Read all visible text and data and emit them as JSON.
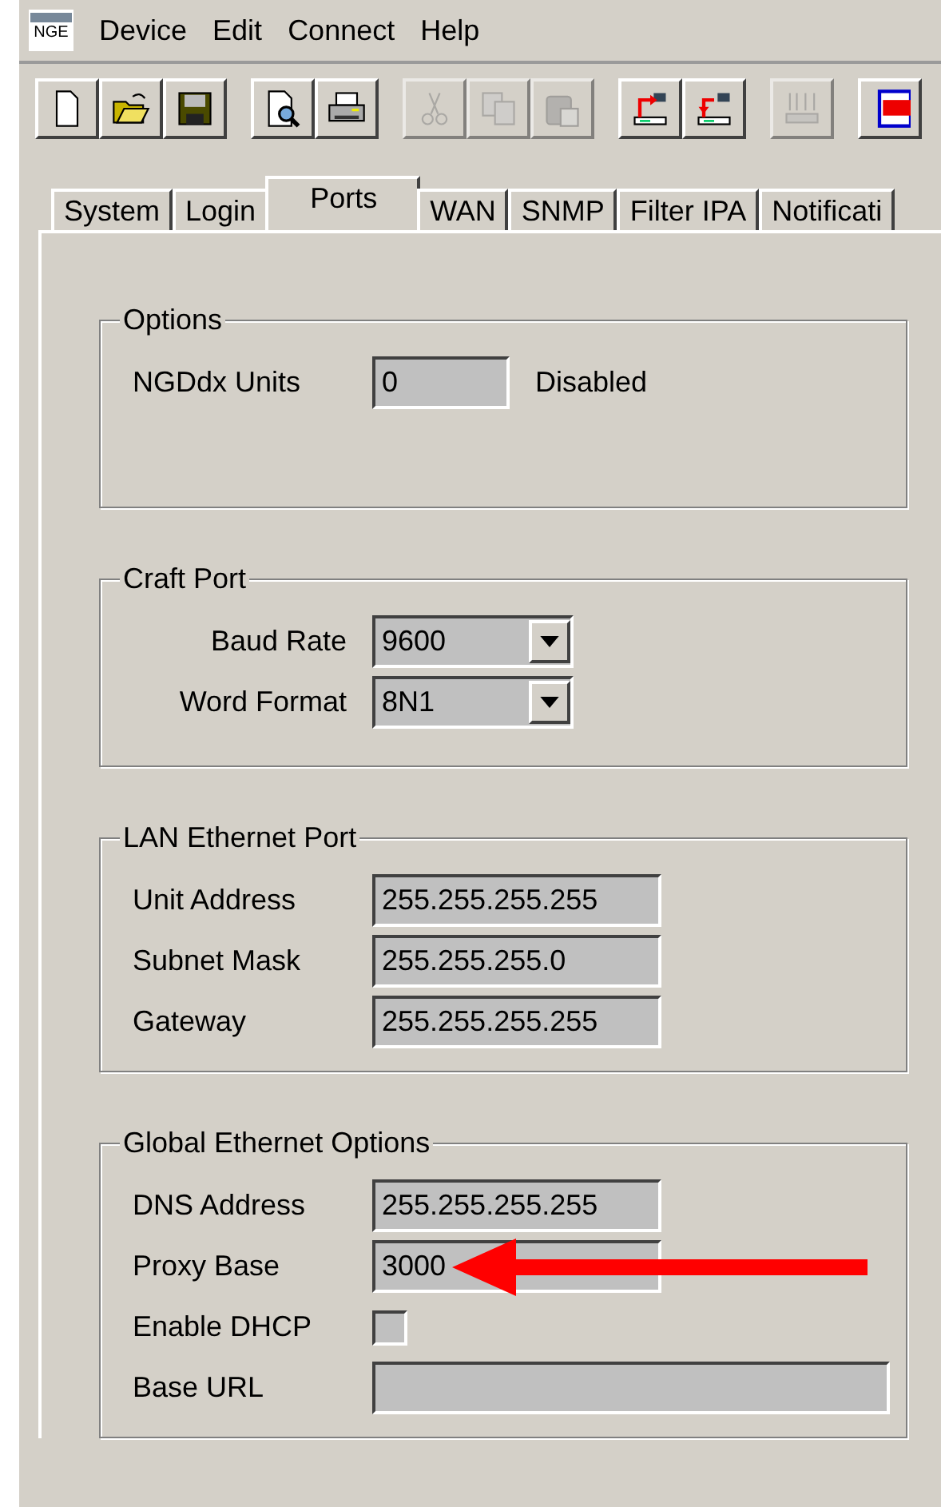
{
  "menu": {
    "app_icon_text": "NGE",
    "items": [
      "Device",
      "Edit",
      "Connect",
      "Help"
    ]
  },
  "toolbar": [
    [
      {
        "kind": "new",
        "disabled": false
      },
      {
        "kind": "open",
        "disabled": false
      },
      {
        "kind": "save",
        "disabled": false
      }
    ],
    [
      {
        "kind": "preview",
        "disabled": false
      },
      {
        "kind": "print",
        "disabled": false
      }
    ],
    [
      {
        "kind": "cut",
        "disabled": true
      },
      {
        "kind": "copy",
        "disabled": true
      },
      {
        "kind": "paste",
        "disabled": true
      }
    ],
    [
      {
        "kind": "upload",
        "disabled": false
      },
      {
        "kind": "download",
        "disabled": false
      }
    ],
    [
      {
        "kind": "firmware",
        "disabled": true
      }
    ],
    [
      {
        "kind": "doc",
        "disabled": false
      }
    ]
  ],
  "tabs": [
    {
      "label": "System",
      "selected": false
    },
    {
      "label": "Login",
      "selected": false
    },
    {
      "label": "Ports",
      "selected": true
    },
    {
      "label": "WAN",
      "selected": false
    },
    {
      "label": "SNMP",
      "selected": false
    },
    {
      "label": "Filter IPA",
      "selected": false
    },
    {
      "label": "Notificati",
      "selected": false
    }
  ],
  "groups": [
    {
      "title": "Options",
      "rows": [
        {
          "kind": "field",
          "label": "NGDdx Units",
          "value": "0",
          "note": "Disabled",
          "marked": false
        }
      ]
    },
    {
      "title": "Craft Port",
      "rows": [
        {
          "kind": "dropdown",
          "label": "Baud Rate",
          "value": "9600"
        },
        {
          "kind": "dropdown",
          "label": "Word Format",
          "value": "8N1"
        }
      ]
    },
    {
      "title": "LAN Ethernet Port",
      "rows": [
        {
          "kind": "field",
          "label": "Unit Address",
          "value": "255.255.255.255",
          "marked": false
        },
        {
          "kind": "field",
          "label": "Subnet Mask",
          "value": "255.255.255.0",
          "marked": false
        },
        {
          "kind": "field",
          "label": "Gateway",
          "value": "255.255.255.255",
          "marked": false
        }
      ]
    },
    {
      "title": "Global Ethernet Options",
      "rows": [
        {
          "kind": "field",
          "label": "DNS Address",
          "value": "255.255.255.255",
          "marked": false
        },
        {
          "kind": "field",
          "label": "Proxy Base",
          "value": "3000",
          "marked": true
        },
        {
          "kind": "checkbox",
          "label": "Enable DHCP",
          "checked": false
        },
        {
          "kind": "wide_field",
          "label": "Base URL"
        }
      ]
    }
  ]
}
